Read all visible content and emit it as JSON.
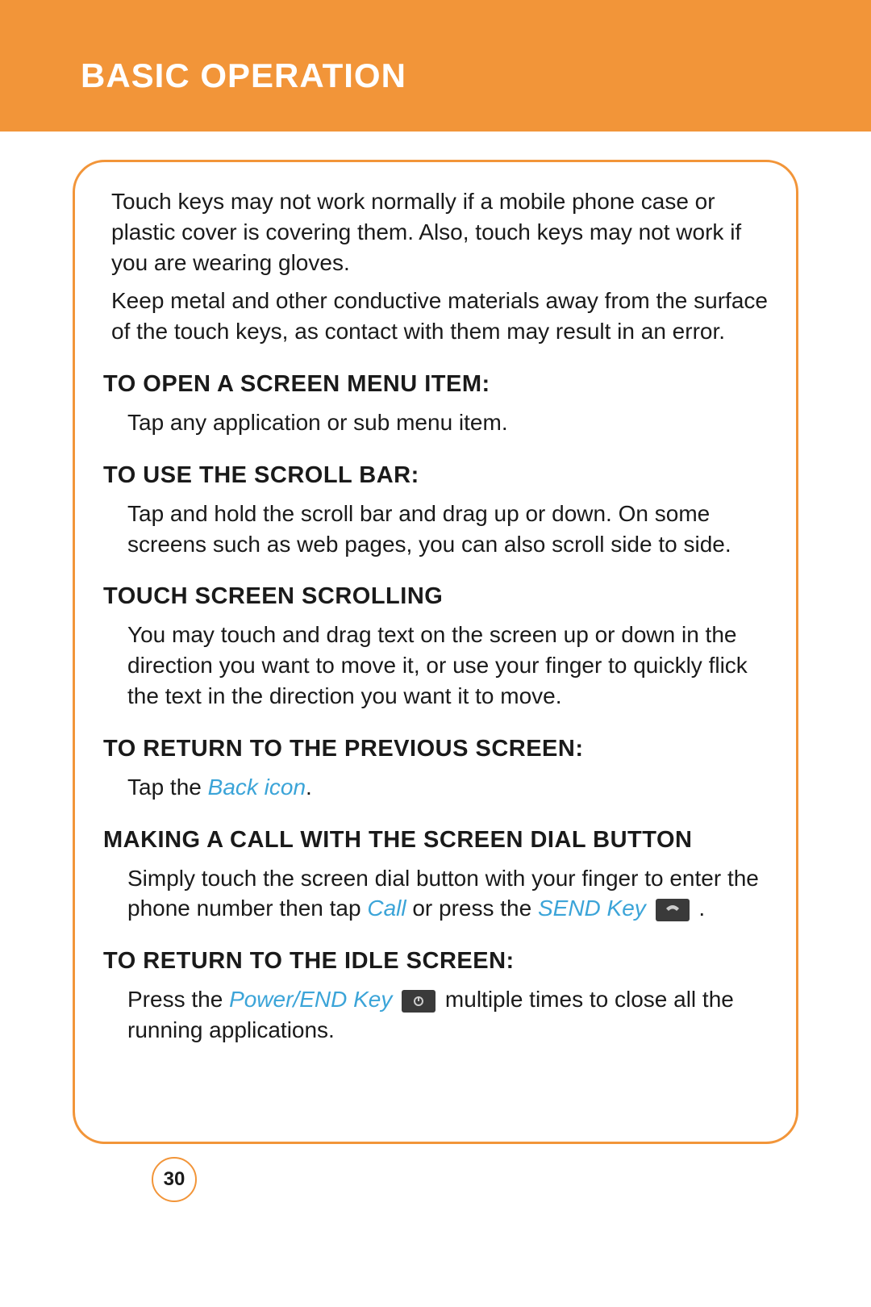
{
  "header": {
    "title": "BASIC OPERATION"
  },
  "intro": {
    "p1": "Touch keys may not work normally if a mobile phone case or plastic cover is covering them. Also, touch keys may not work if you are wearing gloves.",
    "p2": "Keep metal and other conductive materials away from the surface of the touch keys, as contact with them may result in an error."
  },
  "sections": {
    "open_menu": {
      "heading": "TO OPEN A SCREEN MENU ITEM:",
      "body": "Tap any application or sub menu item."
    },
    "scroll_bar": {
      "heading": "TO USE THE SCROLL BAR:",
      "body": "Tap and hold the scroll bar and drag up or down. On some screens such as web pages, you can also scroll side to side."
    },
    "touch_scroll": {
      "heading": "TOUCH SCREEN SCROLLING",
      "body": "You may touch and drag text on the screen up or down in the direction you want to move it, or use your finger to quickly flick the text in the direction you want it to move."
    },
    "return_prev": {
      "heading": "TO RETURN TO THE PREVIOUS SCREEN:",
      "prefix": "Tap the ",
      "link": "Back icon",
      "suffix": "."
    },
    "making_call": {
      "heading": "MAKING A CALL WITH THE SCREEN DIAL BUTTON",
      "part1": "Simply touch the screen dial button with your finger to enter the phone number then tap ",
      "call_link": "Call",
      "part2": " or press the ",
      "send_link": "SEND Key",
      "part3": " ."
    },
    "return_idle": {
      "heading": "TO RETURN TO THE IDLE SCREEN:",
      "part1": "Press the ",
      "power_link": "Power/END Key",
      "part2": " multiple times to close all the running applications."
    }
  },
  "page_number": "30"
}
